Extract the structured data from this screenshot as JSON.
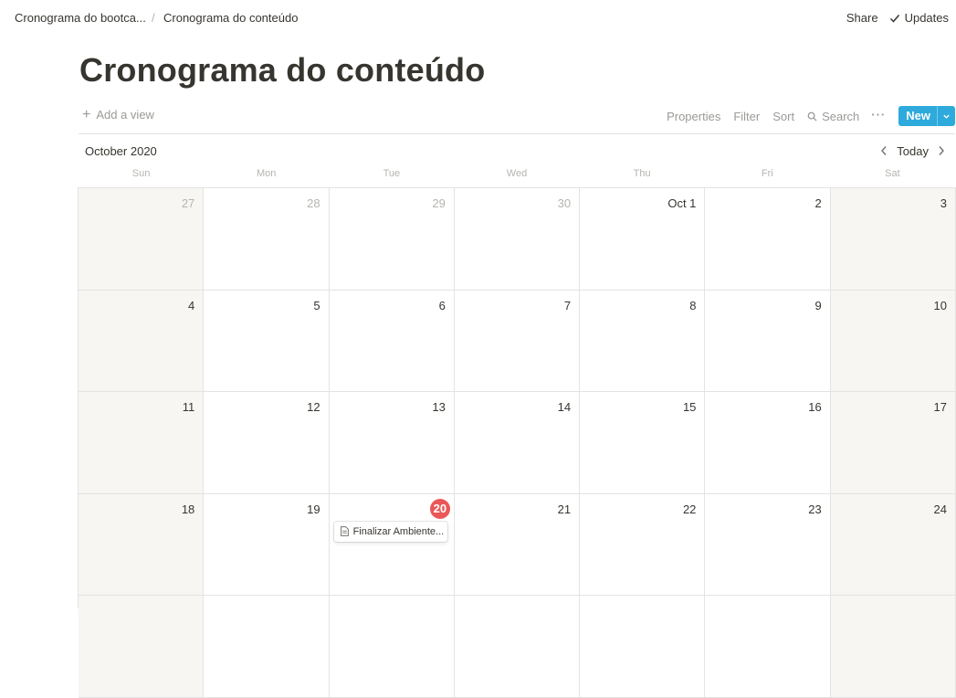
{
  "breadcrumb": {
    "parent": "Cronograma do bootca...",
    "separator": "/",
    "current": "Cronograma do conteúdo"
  },
  "topbar": {
    "share_label": "Share",
    "updates_label": "Updates",
    "updates_icon": "check-icon"
  },
  "page": {
    "title": "Cronograma do conteúdo"
  },
  "viewbar": {
    "add_view_label": "Add a view",
    "properties_label": "Properties",
    "filter_label": "Filter",
    "sort_label": "Sort",
    "search_label": "Search",
    "more_label": "···",
    "new_label": "New",
    "new_color": "#2eaadc"
  },
  "calendar": {
    "month_label": "October 2020",
    "today_label": "Today",
    "weekdays": [
      "Sun",
      "Mon",
      "Tue",
      "Wed",
      "Thu",
      "Fri",
      "Sat"
    ],
    "today_color": "#eb5757",
    "weeks": [
      [
        {
          "label": "27",
          "outside": true,
          "weekend": true
        },
        {
          "label": "28",
          "outside": true
        },
        {
          "label": "29",
          "outside": true
        },
        {
          "label": "30",
          "outside": true
        },
        {
          "label": "Oct 1"
        },
        {
          "label": "2"
        },
        {
          "label": "3",
          "weekend": true
        }
      ],
      [
        {
          "label": "4",
          "weekend": true
        },
        {
          "label": "5"
        },
        {
          "label": "6"
        },
        {
          "label": "7"
        },
        {
          "label": "8"
        },
        {
          "label": "9"
        },
        {
          "label": "10",
          "weekend": true
        }
      ],
      [
        {
          "label": "11",
          "weekend": true
        },
        {
          "label": "12"
        },
        {
          "label": "13"
        },
        {
          "label": "14"
        },
        {
          "label": "15"
        },
        {
          "label": "16"
        },
        {
          "label": "17",
          "weekend": true
        }
      ],
      [
        {
          "label": "18",
          "weekend": true
        },
        {
          "label": "19"
        },
        {
          "label": "20",
          "today": true,
          "events": [
            {
              "title": "Finalizar Ambiente...",
              "icon": "page-icon"
            }
          ]
        },
        {
          "label": "21"
        },
        {
          "label": "22"
        },
        {
          "label": "23"
        },
        {
          "label": "24",
          "weekend": true
        }
      ],
      [
        {
          "label": "",
          "weekend": true
        },
        {
          "label": ""
        },
        {
          "label": ""
        },
        {
          "label": ""
        },
        {
          "label": ""
        },
        {
          "label": ""
        },
        {
          "label": "",
          "weekend": true
        }
      ]
    ]
  }
}
